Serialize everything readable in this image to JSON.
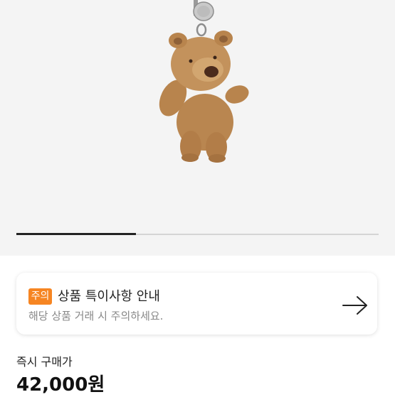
{
  "gallery": {
    "image_subject": "bear-plush-keyring",
    "progress_fraction": 0.33,
    "track_color": "#d4d4d4",
    "fill_color": "#222222"
  },
  "notice": {
    "badge": "주의",
    "badge_color": "#f68522",
    "title": "상품 특이사항 안내",
    "subtitle": "해당 상품 거래 시 주의하세요.",
    "arrow_icon": "arrow-right-icon"
  },
  "price": {
    "label": "즉시 구매가",
    "value": "42,000원"
  }
}
